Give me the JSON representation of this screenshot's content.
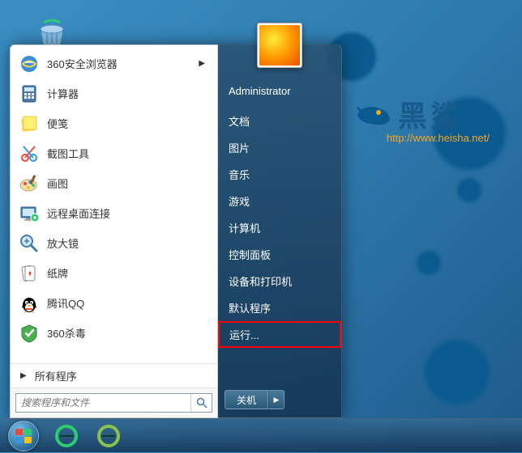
{
  "user": {
    "name": "Administrator"
  },
  "programs": [
    {
      "label": "360安全浏览器",
      "icon": "ie-icon",
      "hasSubmenu": true
    },
    {
      "label": "计算器",
      "icon": "calculator-icon"
    },
    {
      "label": "便笺",
      "icon": "sticky-notes-icon"
    },
    {
      "label": "截图工具",
      "icon": "snipping-icon"
    },
    {
      "label": "画图",
      "icon": "paint-icon"
    },
    {
      "label": "远程桌面连接",
      "icon": "remote-desktop-icon"
    },
    {
      "label": "放大镜",
      "icon": "magnifier-icon"
    },
    {
      "label": "纸牌",
      "icon": "solitaire-icon"
    },
    {
      "label": "腾讯QQ",
      "icon": "qq-icon"
    },
    {
      "label": "360杀毒",
      "icon": "360-antivirus-icon"
    }
  ],
  "allPrograms": "所有程序",
  "search": {
    "placeholder": "搜索程序和文件"
  },
  "rightItems": [
    {
      "label": "文档"
    },
    {
      "label": "图片"
    },
    {
      "label": "音乐"
    },
    {
      "label": "游戏"
    },
    {
      "label": "计算机"
    },
    {
      "label": "控制面板"
    },
    {
      "label": "设备和打印机"
    },
    {
      "label": "默认程序"
    },
    {
      "label": "运行...",
      "highlighted": true
    }
  ],
  "shutdown": {
    "label": "关机"
  },
  "logo": {
    "text": "黑鲨",
    "url": "http://www.heisha.net/"
  }
}
